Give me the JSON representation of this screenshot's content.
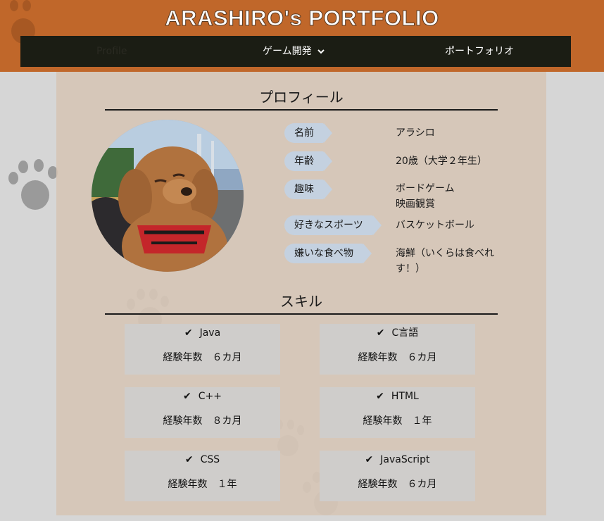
{
  "header": {
    "title": "ARASHIRO's PORTFOLIO",
    "nav": {
      "profile": "Profile",
      "game_dev": "ゲーム開発",
      "portfolio": "ポートフォリオ"
    }
  },
  "profile": {
    "heading": "プロフィール",
    "rows": [
      {
        "label": "名前",
        "value": "アラシロ"
      },
      {
        "label": "年齢",
        "value": "20歳（大学２年生）"
      },
      {
        "label": "趣味",
        "value_line1": "ボードゲーム",
        "value_line2": "映画観賞"
      },
      {
        "label": "好きなスポーツ",
        "value": "バスケットボール"
      },
      {
        "label": "嫌いな食べ物",
        "value_line1": "海鮮（いくらは食べれ",
        "value_line2": "す！）"
      }
    ]
  },
  "skills": {
    "heading": "スキル",
    "items": [
      {
        "name": "Java",
        "experience": "経験年数　６カ月"
      },
      {
        "name": "C言語",
        "experience": "経験年数　６カ月"
      },
      {
        "name": "C++",
        "experience": "経験年数　８カ月"
      },
      {
        "name": "HTML",
        "experience": "経験年数　１年"
      },
      {
        "name": "CSS",
        "experience": "経験年数　１年"
      },
      {
        "name": "JavaScript",
        "experience": "経験年数　６カ月"
      }
    ]
  },
  "icons": {
    "check": "check-icon",
    "chevron": "chevron-down-icon",
    "paw": "paw-print-icon"
  },
  "colors": {
    "header_bg": "#c0672a",
    "nav_bg": "#1b1d14",
    "label_bg": "#c4d1e0",
    "card_bg": "#cfcdcb"
  }
}
